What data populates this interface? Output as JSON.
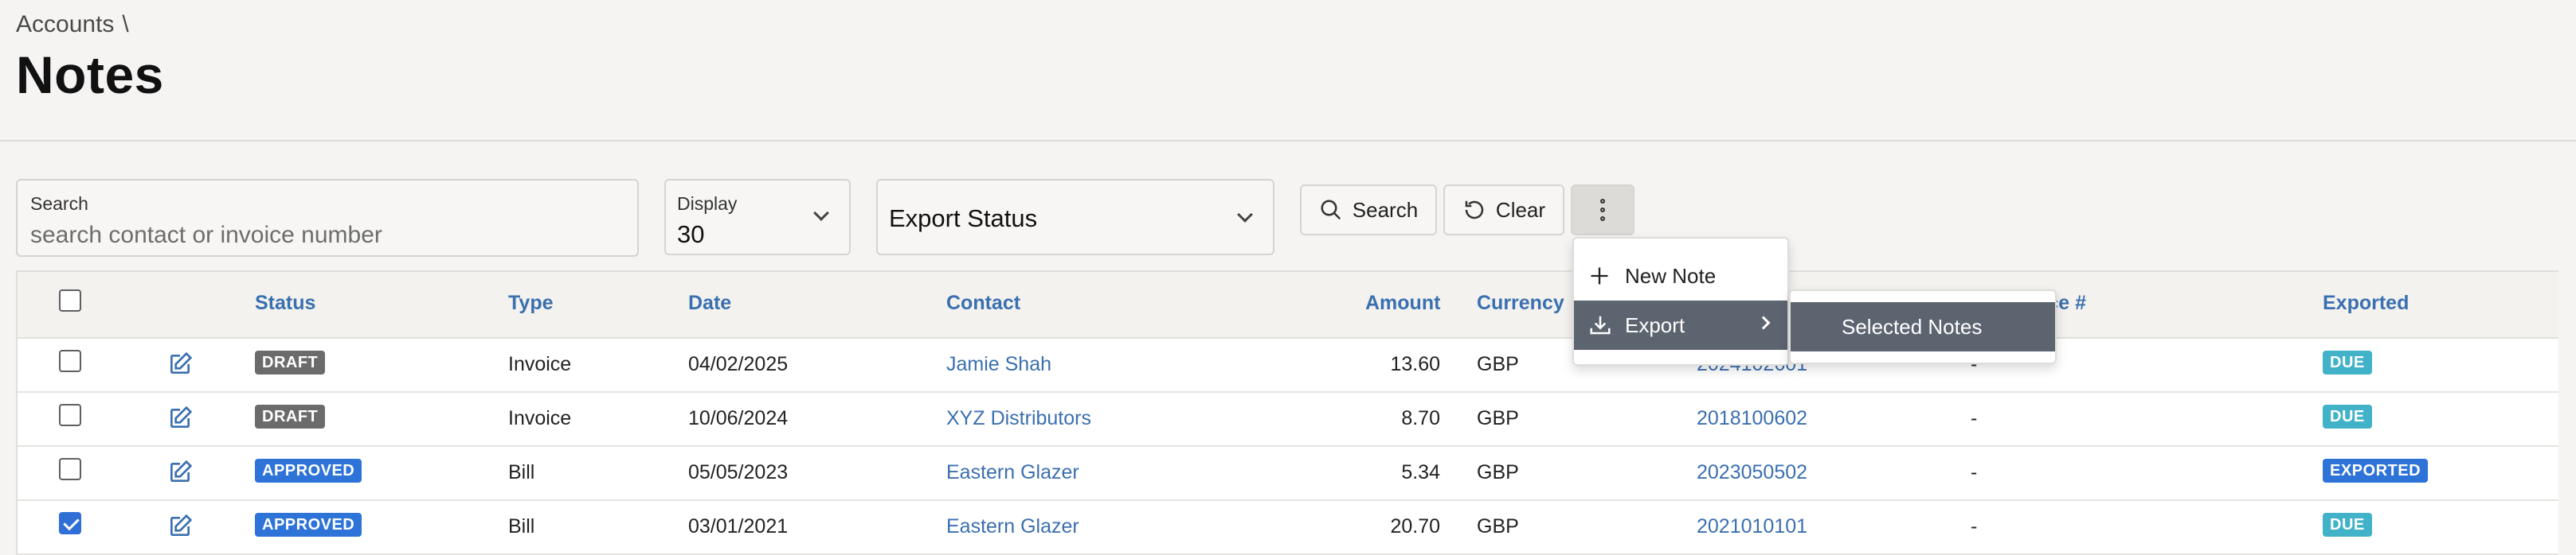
{
  "breadcrumb": {
    "parent": "Accounts",
    "separator": "\\"
  },
  "page_title": "Notes",
  "filters": {
    "search_label": "Search",
    "search_placeholder": "search contact or invoice number",
    "display_label": "Display",
    "display_value": "30",
    "export_status_value": "Export Status"
  },
  "buttons": {
    "search": "Search",
    "clear": "Clear"
  },
  "table": {
    "columns": [
      "Status",
      "Type",
      "Date",
      "Contact",
      "Amount",
      "Currency",
      "Invoice #",
      "Exported"
    ],
    "rows": [
      {
        "checked": false,
        "status": "DRAFT",
        "type": "Invoice",
        "date": "04/02/2025",
        "contact": "Jamie Shah",
        "amount": "13.60",
        "currency": "GBP",
        "number": "2024102601",
        "invoice": "-",
        "exported": "DUE"
      },
      {
        "checked": false,
        "status": "DRAFT",
        "type": "Invoice",
        "date": "10/06/2024",
        "contact": "XYZ Distributors",
        "amount": "8.70",
        "currency": "GBP",
        "number": "2018100602",
        "invoice": "-",
        "exported": "DUE"
      },
      {
        "checked": false,
        "status": "APPROVED",
        "type": "Bill",
        "date": "05/05/2023",
        "contact": "Eastern Glazer",
        "amount": "5.34",
        "currency": "GBP",
        "number": "2023050502",
        "invoice": "-",
        "exported": "EXPORTED"
      },
      {
        "checked": true,
        "status": "APPROVED",
        "type": "Bill",
        "date": "03/01/2021",
        "contact": "Eastern Glazer",
        "amount": "20.70",
        "currency": "GBP",
        "number": "2021010101",
        "invoice": "-",
        "exported": "DUE"
      }
    ]
  },
  "menu": {
    "new_note": "New Note",
    "export": "Export"
  },
  "submenu": {
    "selected_notes": "Selected Notes"
  },
  "colors": {
    "accent_blue": "#3a6fb0",
    "approved_badge": "#2d73d8",
    "draft_badge": "#6b6b6b",
    "due_badge": "#42b2c8",
    "menu_highlight": "#5c6470"
  }
}
